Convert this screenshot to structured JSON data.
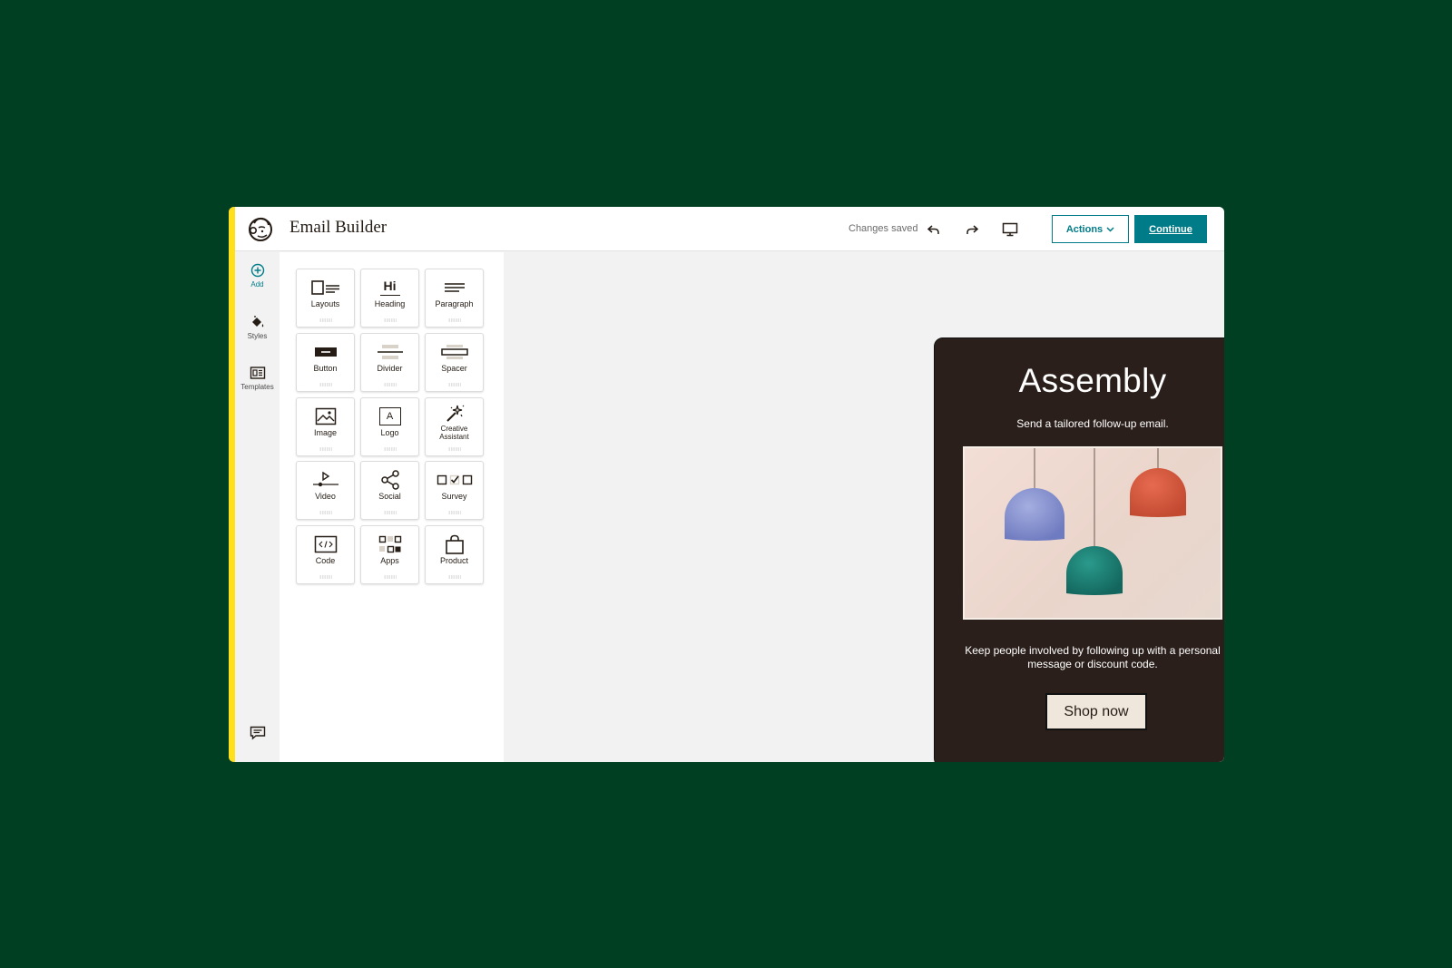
{
  "header": {
    "app_title": "Email Builder",
    "status": "Changes saved",
    "actions_label": "Actions",
    "continue_label": "Continue"
  },
  "rail": {
    "add": "Add",
    "styles": "Styles",
    "templates": "Templates"
  },
  "blocks": [
    {
      "label": "Layouts",
      "icon": "layouts-icon"
    },
    {
      "label": "Heading",
      "icon": "heading-icon"
    },
    {
      "label": "Paragraph",
      "icon": "paragraph-icon"
    },
    {
      "label": "Button",
      "icon": "button-block-icon"
    },
    {
      "label": "Divider",
      "icon": "divider-icon"
    },
    {
      "label": "Spacer",
      "icon": "spacer-icon"
    },
    {
      "label": "Image",
      "icon": "image-icon"
    },
    {
      "label": "Logo",
      "icon": "logo-icon"
    },
    {
      "label": "Creative Assistant",
      "icon": "magic-wand-icon"
    },
    {
      "label": "Video",
      "icon": "video-icon"
    },
    {
      "label": "Social",
      "icon": "share-icon"
    },
    {
      "label": "Survey",
      "icon": "survey-icon"
    },
    {
      "label": "Code",
      "icon": "code-icon"
    },
    {
      "label": "Apps",
      "icon": "apps-icon"
    },
    {
      "label": "Product",
      "icon": "shopping-bag-icon"
    }
  ],
  "heading_glyph": "Hi",
  "logo_glyph": "A",
  "email": {
    "heading": "Assembly",
    "subheading": "Send a tailored follow-up email.",
    "body": "Keep people involved by following up with a personal message or discount code.",
    "button": "Shop now"
  },
  "help_label": "?",
  "colors": {
    "background": "#003f21",
    "accent": "#007c89",
    "yellow": "#ffe01b",
    "email_bg": "#2a1f1a"
  }
}
